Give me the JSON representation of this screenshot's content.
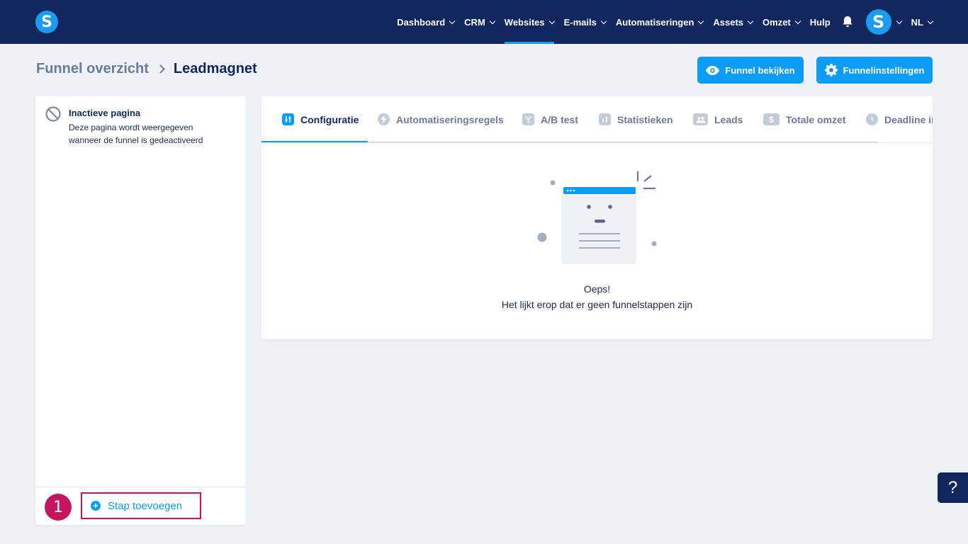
{
  "nav": {
    "logo_letter": "S",
    "items": [
      {
        "label": "Dashboard",
        "active": false
      },
      {
        "label": "CRM",
        "active": false
      },
      {
        "label": "Websites",
        "active": true
      },
      {
        "label": "E-mails",
        "active": false
      },
      {
        "label": "Automatiseringen",
        "active": false
      },
      {
        "label": "Assets",
        "active": false
      },
      {
        "label": "Omzet",
        "active": false
      }
    ],
    "help_label": "Hulp",
    "avatar_letter": "S",
    "language": "NL"
  },
  "breadcrumb": {
    "parent": "Funnel overzicht",
    "current": "Leadmagnet"
  },
  "buttons": {
    "view_funnel": "Funnel bekijken",
    "funnel_settings": "Funnelinstellingen"
  },
  "left_panel": {
    "inactive_title": "Inactieve pagina",
    "inactive_desc": "Deze pagina wordt weergegeven wanneer de funnel is gedeactiveerd",
    "step_number": "1",
    "add_step_label": "Stap toevoegen"
  },
  "tabs": [
    {
      "label": "Configuratie",
      "icon": "sliders-icon",
      "active": true
    },
    {
      "label": "Automatiseringsregels",
      "icon": "bolt-icon",
      "active": false
    },
    {
      "label": "A/B test",
      "icon": "split-icon",
      "active": false
    },
    {
      "label": "Statistieken",
      "icon": "bar-chart-icon",
      "active": false
    },
    {
      "label": "Leads",
      "icon": "users-icon",
      "active": false
    },
    {
      "label": "Totale omzet",
      "icon": "dollar-icon",
      "active": false
    },
    {
      "label": "Deadline in",
      "icon": "clock-icon",
      "active": false
    }
  ],
  "empty_state": {
    "title": "Oeps!",
    "message": "Het lijkt erop dat er geen funnelstappen zijn"
  },
  "help_button": "?",
  "colors": {
    "navbar": "#12275e",
    "primary": "#0d9cf5",
    "highlight": "#c6145e",
    "background": "#eef2f7"
  }
}
